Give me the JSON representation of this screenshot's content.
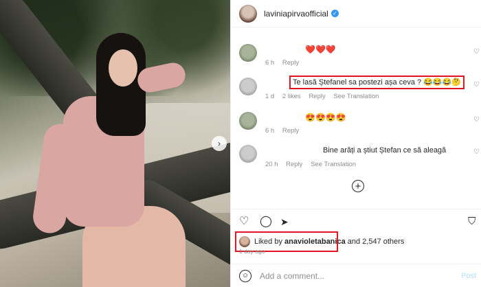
{
  "post": {
    "username": "laviniapirvaofficial",
    "verified_glyph": "✓"
  },
  "comments": [
    {
      "text": "❤️❤️❤️",
      "time": "6 h",
      "reply": "Reply",
      "likes": "",
      "translate": ""
    },
    {
      "text": "Te lasă Ștefanel sa postezi așa ceva ? 😂😂😂🤔",
      "time": "1 d",
      "likes": "2 likes",
      "reply": "Reply",
      "translate": "See Translation"
    },
    {
      "text": "😍😍😍😍",
      "time": "6 h",
      "reply": "Reply",
      "likes": "",
      "translate": ""
    },
    {
      "text": "Bine arăți a știut Ștefan ce să aleagă",
      "time": "20 h",
      "reply": "Reply",
      "likes": "",
      "translate": "See Translation"
    }
  ],
  "likes": {
    "prefix": "Liked by",
    "user": "anavioletabanica",
    "suffix": "and 2,547 others"
  },
  "date": "1 day ago",
  "add_comment": {
    "placeholder": "Add a comment...",
    "post_label": "Post"
  },
  "icons": {
    "heart": "heart-icon",
    "comment": "comment-icon",
    "share": "share-icon",
    "save": "bookmark-icon",
    "emoji": "emoji-icon",
    "add": "add-circle-icon",
    "next": "chevron-right-icon"
  },
  "colors": {
    "highlight": "#e0151f",
    "verified": "#3897f0",
    "muted": "#8e8e8e",
    "post_button": "#b2dffc"
  }
}
